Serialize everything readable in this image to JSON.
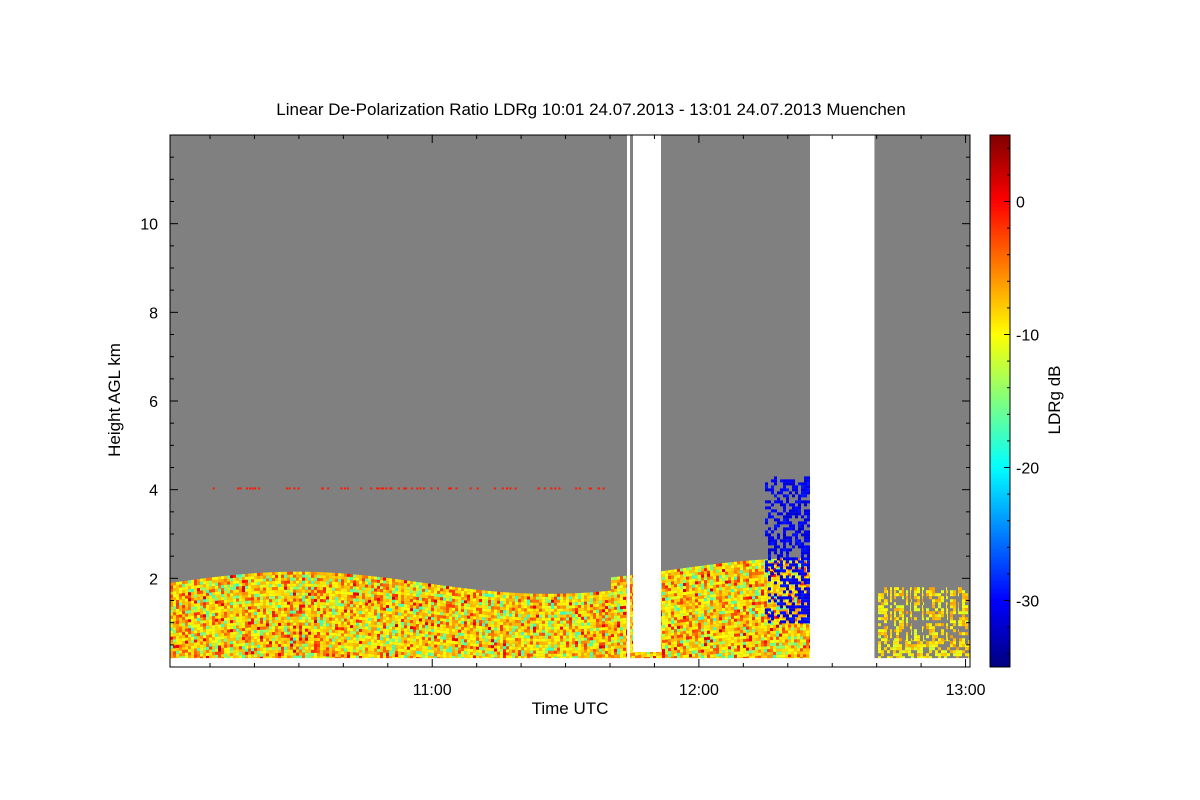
{
  "chart_data": {
    "type": "heatmap",
    "title": "Linear De-Polarization Ratio LDRg   10:01 24.07.2013 - 13:01 24.07.2013 Muenchen",
    "xlabel": "Time UTC",
    "ylabel": "Height AGL km",
    "colorbar_label": "LDRg dB",
    "x_range_minutes": [
      601,
      781
    ],
    "y_range_km": [
      0,
      12
    ],
    "color_range_db": [
      -35,
      5
    ],
    "x_ticks": [
      {
        "minutes": 660,
        "label": "11:00"
      },
      {
        "minutes": 720,
        "label": "12:00"
      },
      {
        "minutes": 780,
        "label": "13:00"
      }
    ],
    "y_ticks": [
      {
        "km": 2,
        "label": "2"
      },
      {
        "km": 4,
        "label": "4"
      },
      {
        "km": 6,
        "label": "6"
      },
      {
        "km": 8,
        "label": "8"
      },
      {
        "km": 10,
        "label": "10"
      }
    ],
    "colorbar_ticks": [
      {
        "db": 0,
        "label": "0"
      },
      {
        "db": -10,
        "label": "-10"
      },
      {
        "db": -20,
        "label": "-20"
      },
      {
        "db": -30,
        "label": "-30"
      }
    ],
    "colormap": [
      "#00007f",
      "#0000ff",
      "#007fff",
      "#00ffff",
      "#7fff7f",
      "#ffff00",
      "#ff7f00",
      "#ff0000",
      "#7f0000"
    ],
    "background_color": "#808080",
    "nodata_color": "#ffffff",
    "nodata_intervals_minutes": [
      [
        745,
        759.5
      ]
    ]
  }
}
